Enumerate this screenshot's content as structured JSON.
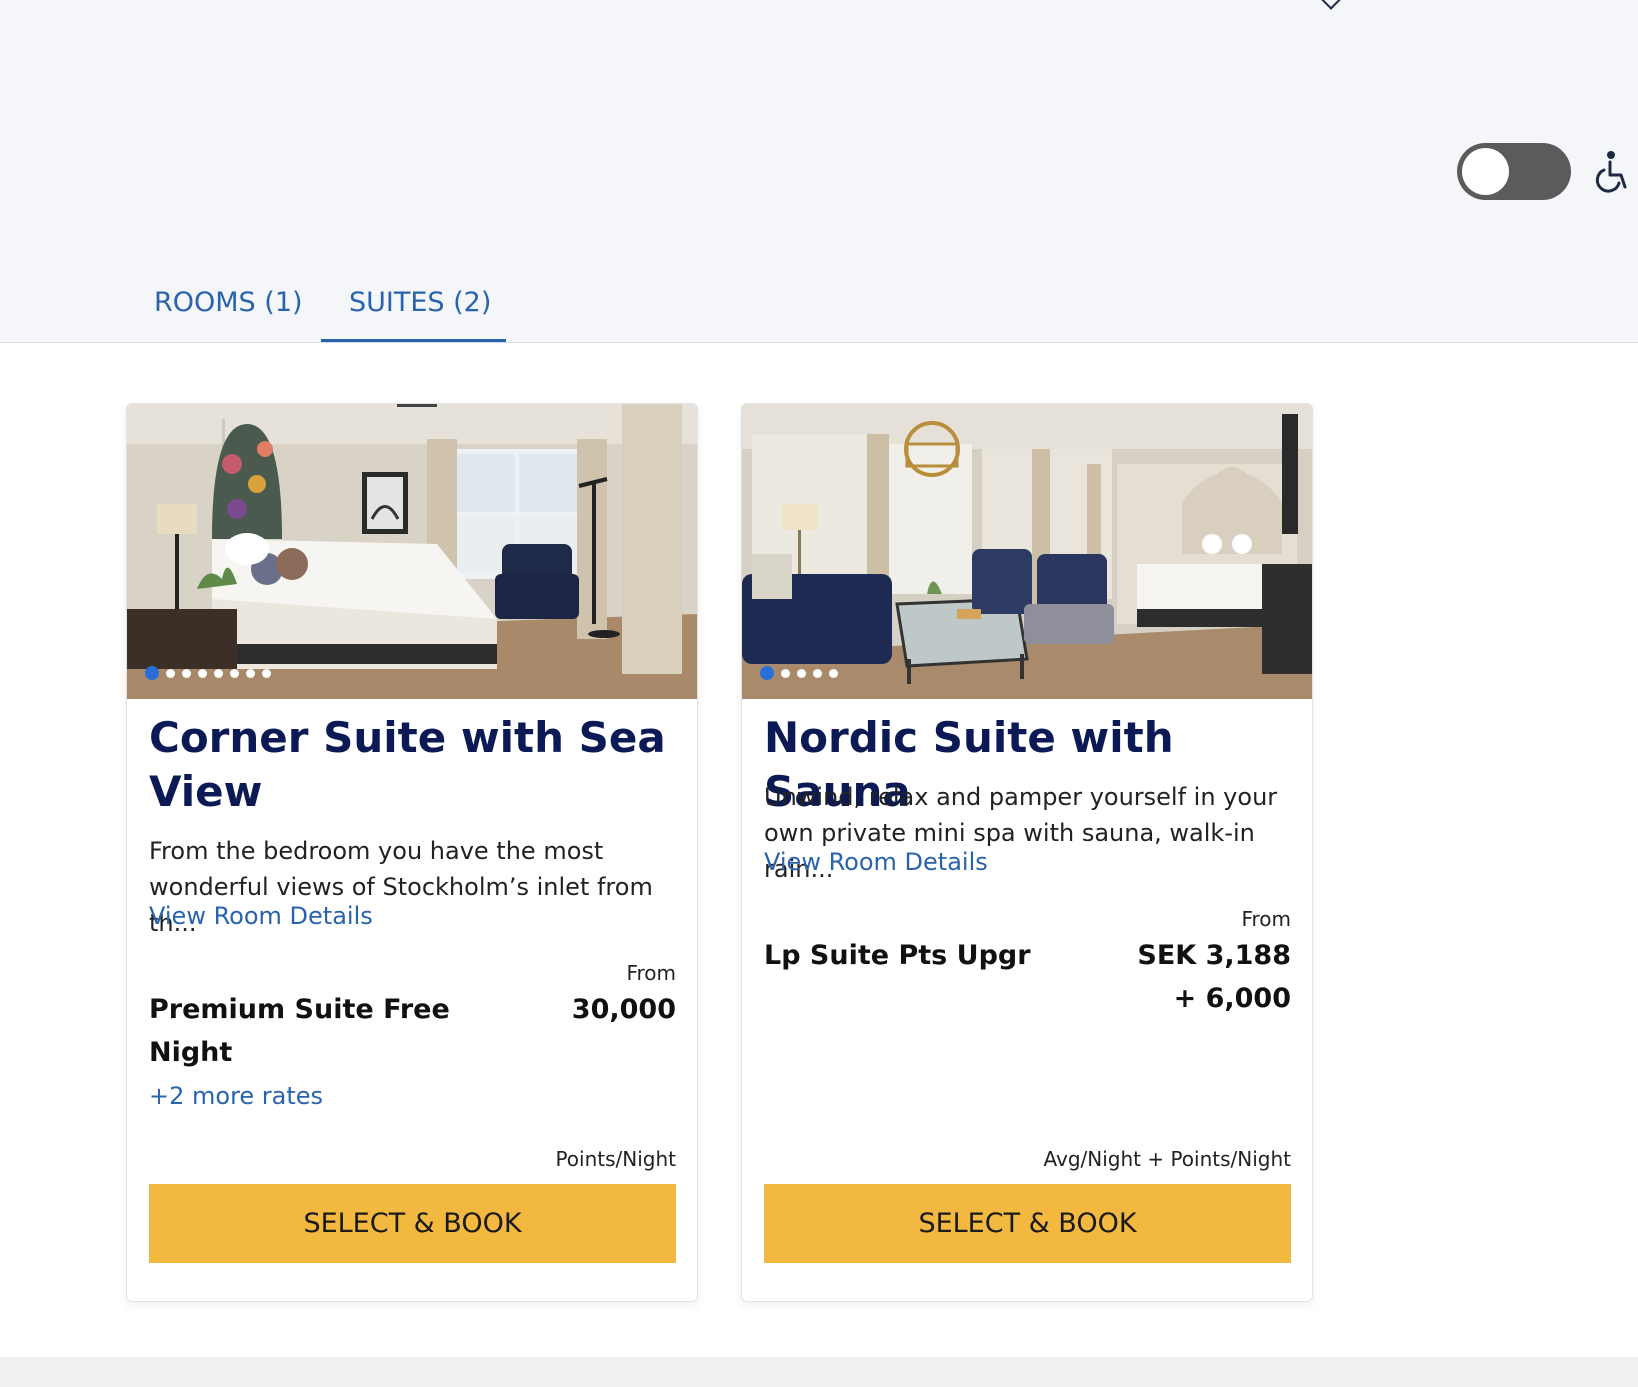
{
  "tabs": [
    {
      "label": "ROOMS (1)",
      "selected": false
    },
    {
      "label": "SUITES (2)",
      "selected": true
    }
  ],
  "accessible_toggle": {
    "on": false,
    "icon": "wheelchair-icon"
  },
  "cards": [
    {
      "title": "Corner Suite with Sea View",
      "description": "From the bedroom you have the most wonderful views of Stockholm’s inlet from th...",
      "details_link": "View Room Details",
      "from_label": "From",
      "rate_name": "Premium Suite Free Night",
      "price_line1": "30,000",
      "price_line2": "",
      "more_rates": "+2 more rates",
      "unit_label": "Points/Night",
      "button_label": "SELECT & BOOK",
      "photo_count": 8,
      "active_photo": 1
    },
    {
      "title": "Nordic Suite with Sauna",
      "description": "Unwind, relax and pamper yourself in your own private mini spa with sauna, walk-in rain...",
      "details_link": "View Room Details",
      "from_label": "From",
      "rate_name": "Lp Suite Pts Upgr",
      "price_line1": "SEK 3,188",
      "price_line2": "+ 6,000",
      "more_rates": "",
      "unit_label": "Avg/Night + Points/Night",
      "button_label": "SELECT & BOOK",
      "photo_count": 5,
      "active_photo": 1
    }
  ],
  "colors": {
    "accent": "#2a63ad",
    "title": "#0b1a55",
    "button": "#f2b83f",
    "active_dot": "#2a6fd8"
  }
}
